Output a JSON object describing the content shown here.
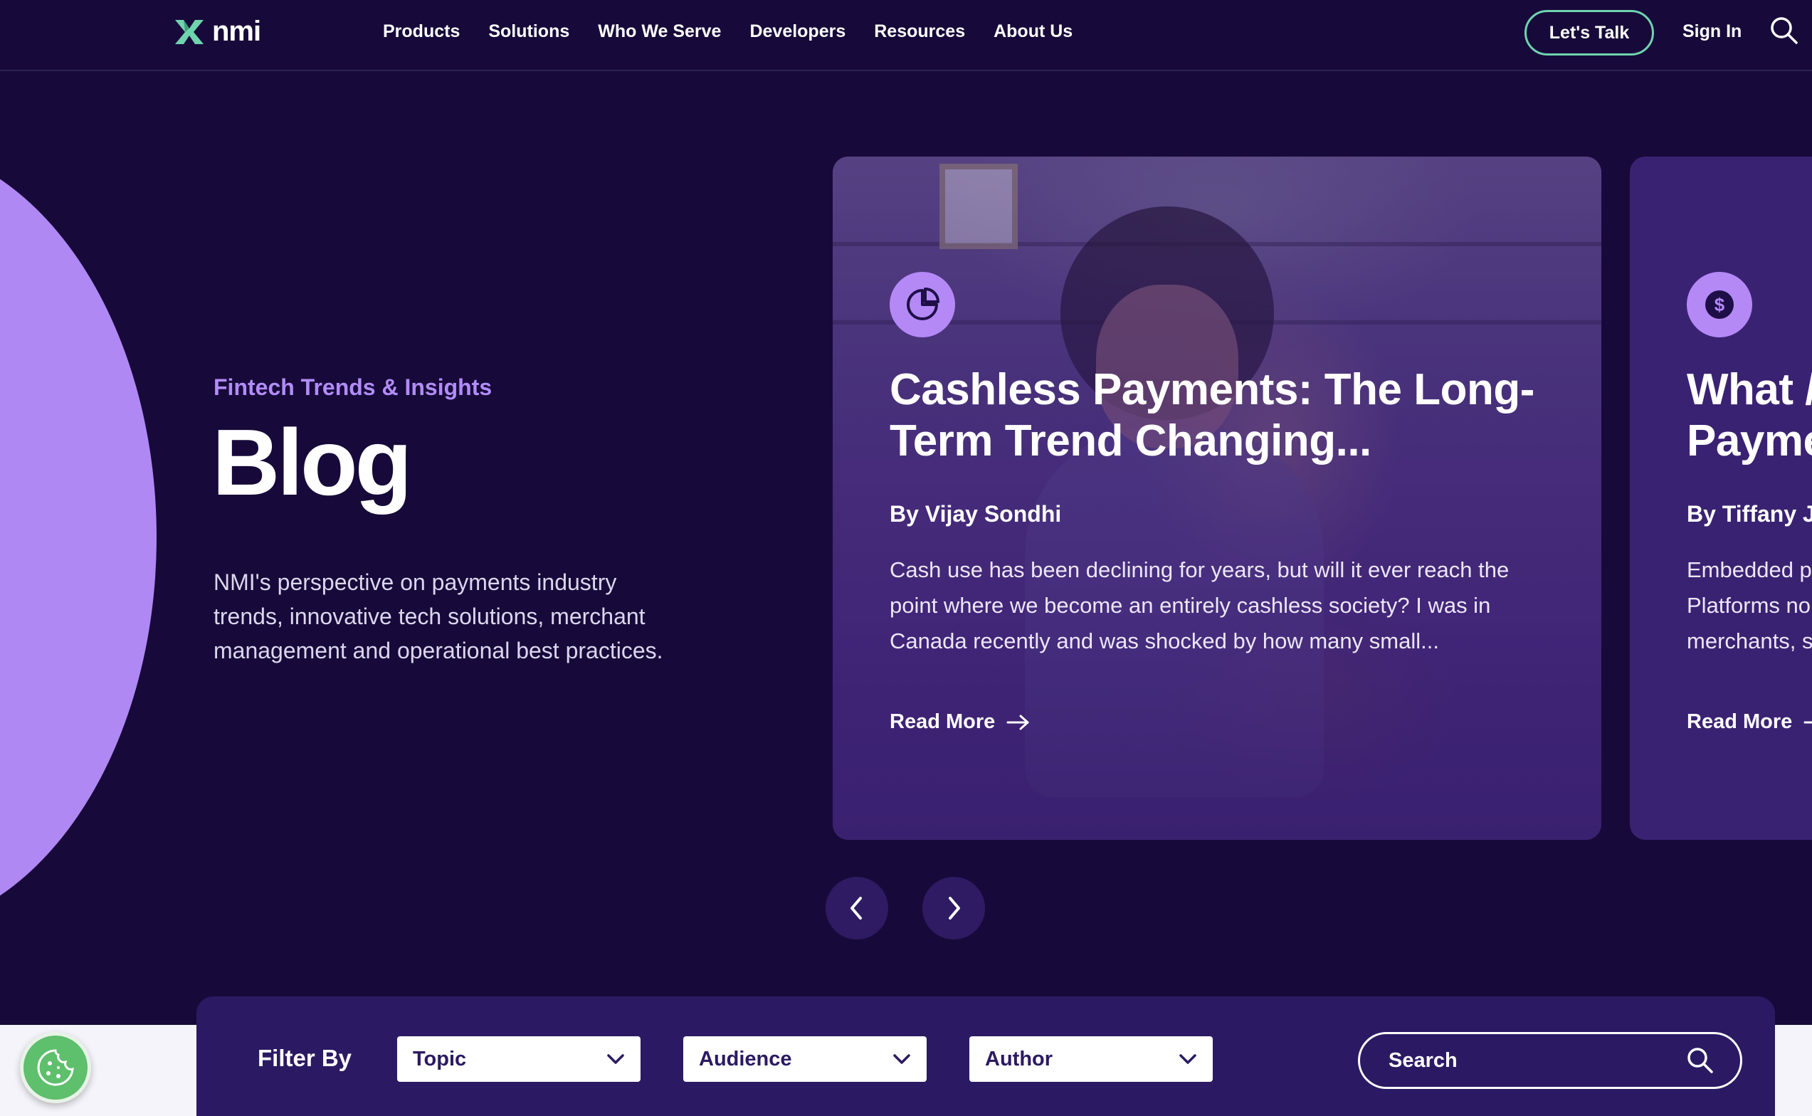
{
  "header": {
    "logo_text": "nmi",
    "nav": [
      {
        "label": "Products"
      },
      {
        "label": "Solutions"
      },
      {
        "label": "Who We Serve"
      },
      {
        "label": "Developers"
      },
      {
        "label": "Resources"
      },
      {
        "label": "About Us"
      }
    ],
    "cta_label": "Let's Talk",
    "sign_in_label": "Sign In"
  },
  "hero": {
    "eyebrow": "Fintech Trends & Insights",
    "title": "Blog",
    "description": "NMI's perspective on payments industry trends, innovative tech solutions, merchant management and operational best practices."
  },
  "cards": [
    {
      "icon": "pie-chart-icon",
      "title": "Cashless Payments: The Long-Term Trend Changing...",
      "author": "By Vijay Sondhi",
      "excerpt": "Cash use has been declining for years, but will it ever reach the point where we become an entirely cashless society? I was in Canada recently and was shocked by how many small...",
      "read_more": "Read More"
    },
    {
      "icon": "dollar-icon",
      "title": "What / Payme",
      "author": "By Tiffany J",
      "excerpt": "Embedded p Platforms no merchants, s",
      "read_more": "Read More"
    }
  ],
  "filter": {
    "label": "Filter By",
    "selects": [
      {
        "value": "Topic"
      },
      {
        "value": "Audience"
      },
      {
        "value": "Author"
      }
    ],
    "search_placeholder": "Search"
  },
  "colors": {
    "background": "#170a3a",
    "accent_purple": "#b489f6",
    "accent_green": "#6fd3ae",
    "filter_bar": "#2b1a63",
    "cookie_green": "#5ebf6c"
  }
}
